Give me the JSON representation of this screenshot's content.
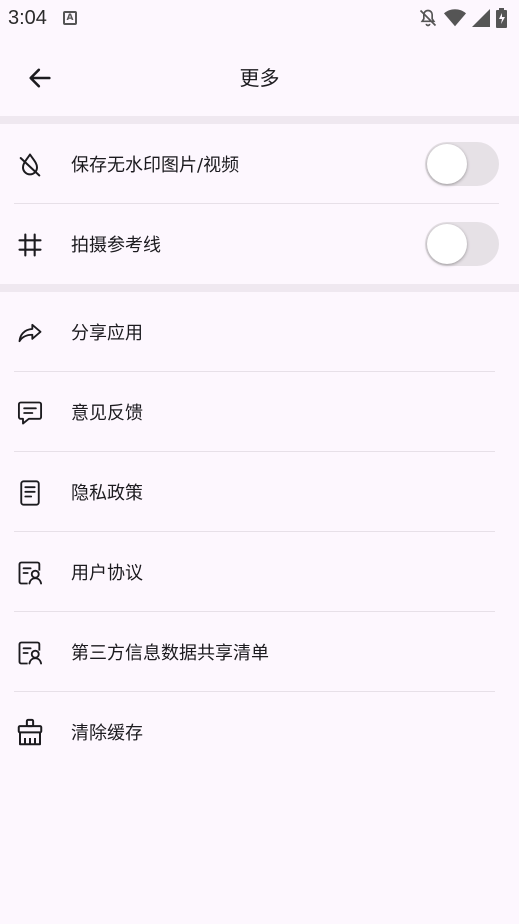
{
  "status_bar": {
    "time": "3:04",
    "notification_icon": "A"
  },
  "app_bar": {
    "title": "更多",
    "back_icon": "arrow-left-icon"
  },
  "settings": [
    {
      "label": "保存无水印图片/视频",
      "icon": "drop-slash-icon",
      "toggle_on": false
    },
    {
      "label": "拍摄参考线",
      "icon": "hash-icon",
      "toggle_on": false
    }
  ],
  "menu": [
    {
      "label": "分享应用",
      "icon": "share-icon"
    },
    {
      "label": "意见反馈",
      "icon": "message-icon"
    },
    {
      "label": "隐私政策",
      "icon": "document-icon"
    },
    {
      "label": "用户协议",
      "icon": "user-list-icon"
    },
    {
      "label": "第三方信息数据共享清单",
      "icon": "user-list-icon"
    },
    {
      "label": "清除缓存",
      "icon": "broom-icon"
    }
  ]
}
